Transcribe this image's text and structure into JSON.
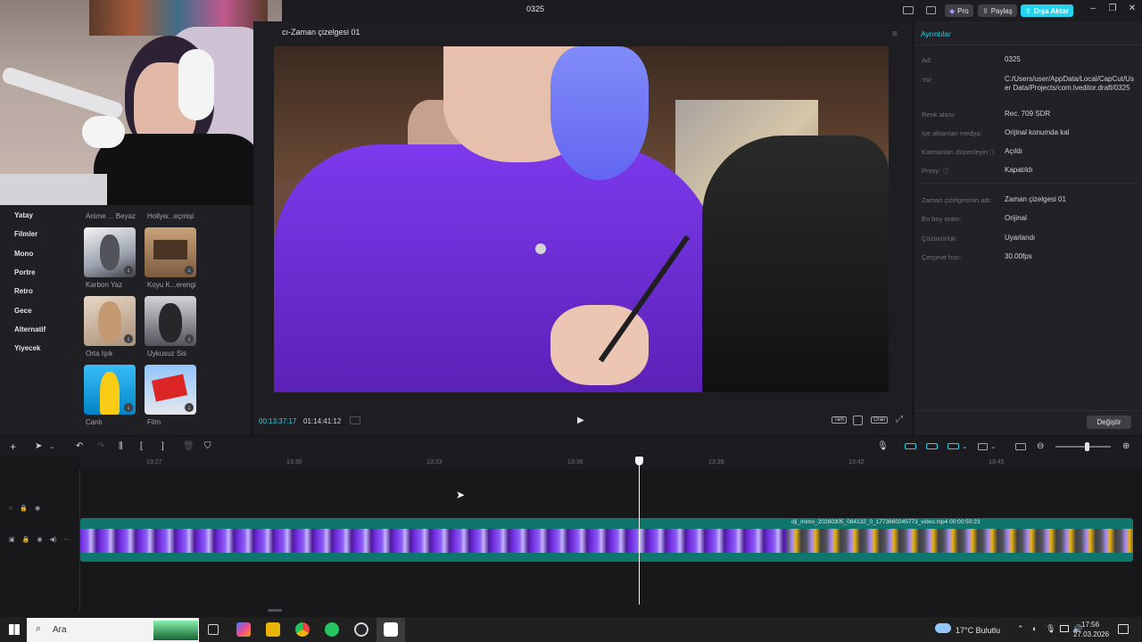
{
  "window": {
    "title": "0325",
    "pro_label": "Pro",
    "share_label": "Paylaş",
    "export_label": "Dışa Aktar",
    "accent_color": "#22d3ee"
  },
  "left_panel": {
    "categories": [
      "Yatay",
      "Filmler",
      "Mono",
      "Portre",
      "Retro",
      "Gece",
      "Alternatif",
      "Yiyecek"
    ],
    "top_labels": [
      "Anime ... Beyaz",
      "Hollyw...eçmişi"
    ],
    "filters": [
      {
        "label": "Karbon Yaz"
      },
      {
        "label": "Koyu K...erengi"
      },
      {
        "label": "Orta Işık"
      },
      {
        "label": "Uykusuz Sis"
      },
      {
        "label": "Canlı"
      },
      {
        "label": "Film"
      }
    ]
  },
  "player": {
    "timeline_name": "cı-Zaman çizelgesi 01",
    "current_time": "00:13:37:17",
    "total_time": "01:14:41:12",
    "full_label": "Tam",
    "ratio_label": "Oran"
  },
  "details": {
    "header": "Ayrıntılar",
    "rows": [
      {
        "label": "Ad:",
        "value": "0325"
      },
      {
        "label": "Yol:",
        "value": "C:/Users/user/AppData/Local/CapCut/User Data/Projects/com.lveditor.draft/0325"
      },
      {
        "label": "Renk alanı:",
        "value": "Rec. 709 SDR"
      },
      {
        "label": "İçe aktarılan medya:",
        "value": "Orijinal konumda kal"
      },
      {
        "label": "Katmanları düzenleyin",
        "value": "Açıldı"
      },
      {
        "label": "Proxy:",
        "value": "Kapatıldı"
      },
      {
        "label": "Zaman çizelgesinin adı:",
        "value": "Zaman çizelgesi 01"
      },
      {
        "label": "En boy oranı:",
        "value": "Orijinal"
      },
      {
        "label": "Çözünürlük:",
        "value": "Uyarlandı"
      },
      {
        "label": "Çerçeve hızı:",
        "value": "30.00fps"
      }
    ],
    "modify_label": "Değiştir"
  },
  "timeline": {
    "ticks": [
      "13:27",
      "13:30",
      "13:33",
      "13:36",
      "13:39",
      "13:42",
      "13:45"
    ],
    "clip_label": "dji_mimo_20260305_084132_0_1773660245773_video.mp4   00:00:50:23",
    "clip_color": "#14b8a6"
  },
  "taskbar": {
    "search_label": "Ara",
    "weather": "17°C  Bulutlu",
    "time": "17:56",
    "date": "27.03.2026"
  }
}
